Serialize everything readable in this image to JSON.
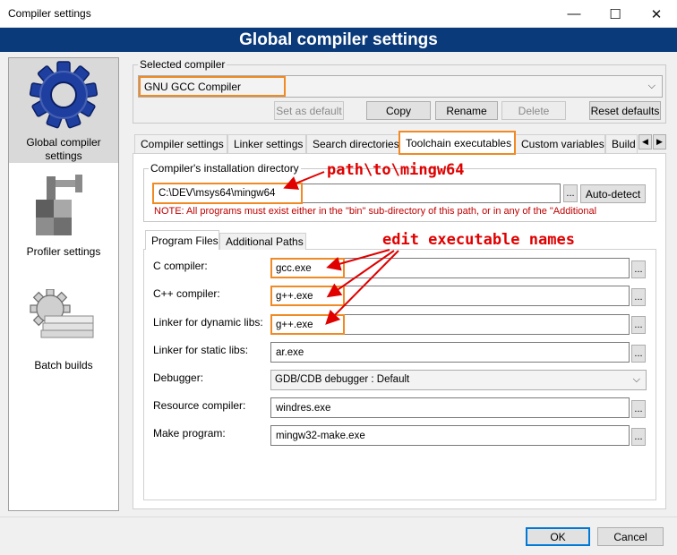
{
  "window": {
    "title": "Compiler settings",
    "minimize": "—",
    "maximize": "☐",
    "close": "✕"
  },
  "header": {
    "title": "Global compiler settings"
  },
  "sidebar": {
    "items": [
      {
        "label": "Global compiler settings",
        "icon": "gear-icon",
        "selected": true
      },
      {
        "label": "Profiler settings",
        "icon": "profiler-icon"
      },
      {
        "label": "Batch builds",
        "icon": "batch-builds-icon"
      }
    ]
  },
  "selected_compiler": {
    "label": "Selected compiler",
    "value": "GNU GCC Compiler"
  },
  "compiler_buttons": {
    "set_default": "Set as default",
    "copy": "Copy",
    "rename": "Rename",
    "delete": "Delete",
    "reset": "Reset defaults"
  },
  "tabs": [
    "Compiler settings",
    "Linker settings",
    "Search directories",
    "Toolchain executables",
    "Custom variables",
    "Build"
  ],
  "active_tab": "Toolchain executables",
  "install_dir": {
    "label": "Compiler's installation directory",
    "value": "C:\\DEV\\msys64\\mingw64",
    "browse": "...",
    "auto_detect": "Auto-detect",
    "note": "NOTE: All programs must exist either in the \"bin\" sub-directory of this path, or in any of the \"Additional"
  },
  "sub_tabs": [
    "Program Files",
    "Additional Paths"
  ],
  "programs": [
    {
      "label": "C compiler:",
      "value": "gcc.exe"
    },
    {
      "label": "C++ compiler:",
      "value": "g++.exe"
    },
    {
      "label": "Linker for dynamic libs:",
      "value": "g++.exe"
    },
    {
      "label": "Linker for static libs:",
      "value": "ar.exe"
    },
    {
      "label": "Debugger:",
      "value": "GDB/CDB debugger : Default"
    },
    {
      "label": "Resource compiler:",
      "value": "windres.exe"
    },
    {
      "label": "Make program:",
      "value": "mingw32-make.exe"
    }
  ],
  "browse_label": "...",
  "annotations": {
    "path": "path\\to\\mingw64",
    "executables": "edit executable names"
  },
  "footer": {
    "ok": "OK",
    "cancel": "Cancel"
  },
  "colors": {
    "header_bg": "#0a3a7a",
    "highlight": "#f08a24",
    "annotation": "#e00000",
    "note": "#c00000"
  }
}
